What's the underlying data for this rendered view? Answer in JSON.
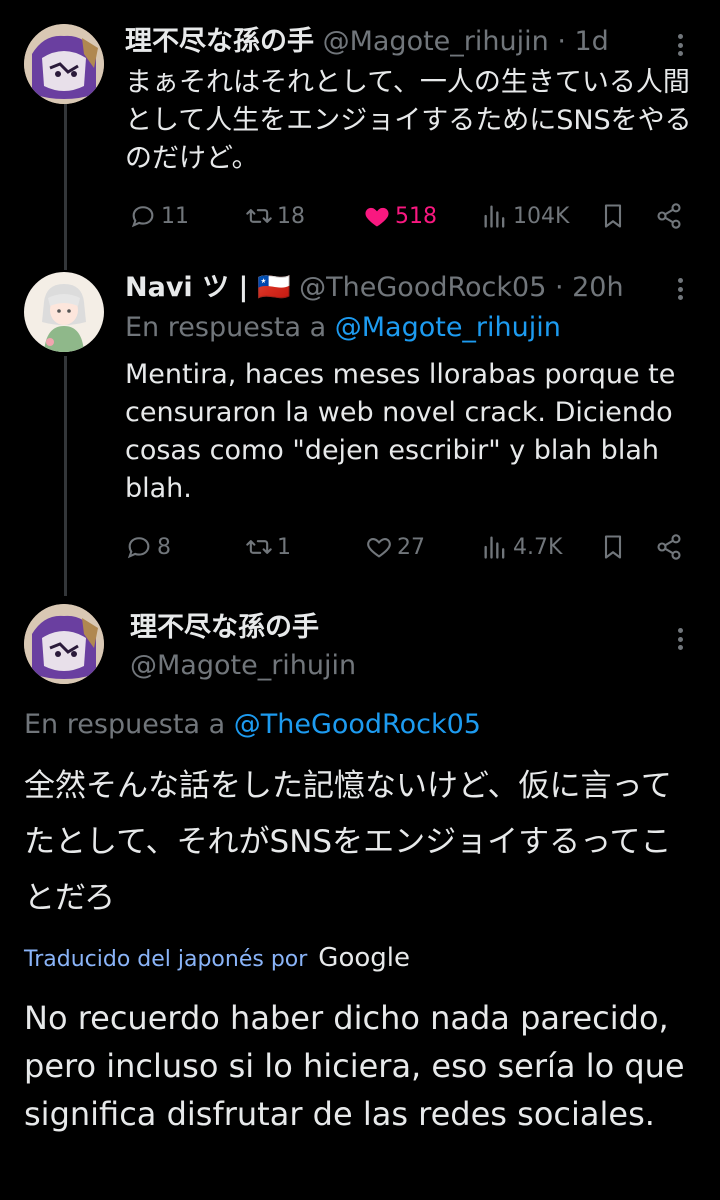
{
  "tweet1": {
    "name": "理不尽な孫の手",
    "handle": "@Magote_rihujin",
    "time": "· 1d",
    "text": "まぁそれはそれとして、一人の生きている人間として人生をエンジョイするためにSNSをやるのだけど。",
    "replies": "11",
    "retweets": "18",
    "likes": "518",
    "views": "104K"
  },
  "tweet2": {
    "name": "Navi ツ |",
    "flag": "🇨🇱",
    "handle": "@TheGoodRock05",
    "time": "· 20h",
    "reply_prefix": "En respuesta a",
    "reply_to": "@Magote_rihujin",
    "text": "Mentira, haces meses llorabas porque te censuraron la web novel crack. Diciendo cosas como \"dejen escribir\" y blah blah blah.",
    "replies": "8",
    "retweets": "1",
    "likes": "27",
    "views": "4.7K"
  },
  "tweet3": {
    "name": "理不尽な孫の手",
    "handle": "@Magote_rihujin",
    "reply_prefix": "En respuesta a",
    "reply_to": "@TheGoodRock05",
    "text": "全然そんな話をした記憶ないけど、仮に言ってたとして、それがSNSをエンジョイするってことだろ",
    "translated_by": "Traducido del japonés por",
    "translator": "Google",
    "translation": "No recuerdo haber dicho nada parecido, pero incluso si lo hiciera, eso sería lo que significa disfrutar de las redes sociales."
  },
  "colors": {
    "background": "#000000",
    "text": "#e7e9ea",
    "muted": "#71767b",
    "link": "#1d9bf0",
    "like": "#f91880",
    "translate_link": "#8ab4f8"
  }
}
